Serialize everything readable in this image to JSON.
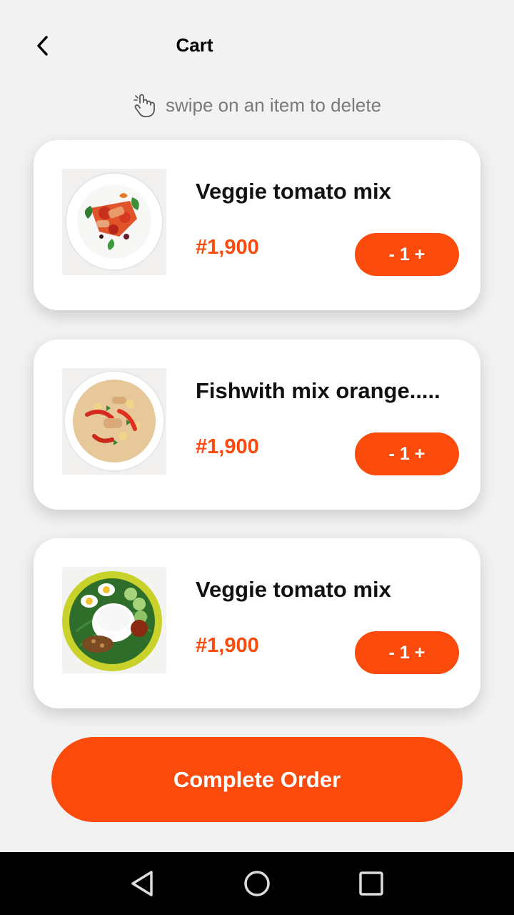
{
  "header": {
    "title": "Cart",
    "back_icon": "chevron-left-icon"
  },
  "hint": {
    "icon": "swipe-hand-icon",
    "text": "swipe on an item to delete"
  },
  "cart": {
    "items": [
      {
        "name": "Veggie tomato mix",
        "price": "#1,900",
        "quantity_label": "- 1 +",
        "image": "veggie-tomato-plate"
      },
      {
        "name": "Fishwith mix orange.....",
        "price": "#1,900",
        "quantity_label": "- 1 +",
        "image": "fish-orange-plate"
      },
      {
        "name": "Veggie tomato mix",
        "price": "#1,900",
        "quantity_label": "- 1 +",
        "image": "rice-egg-plate"
      }
    ]
  },
  "actions": {
    "complete_label": "Complete Order"
  },
  "navbar": {
    "back_icon": "triangle-back-icon",
    "home_icon": "circle-home-icon",
    "recents_icon": "square-recents-icon"
  },
  "colors": {
    "accent": "#FA4A0C",
    "background": "#F2F2F2",
    "card": "#FFFFFF",
    "navbar": "#000000"
  }
}
